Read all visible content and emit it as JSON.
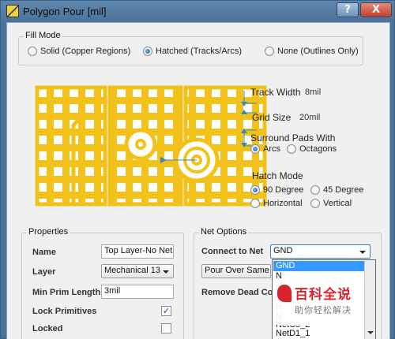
{
  "window": {
    "title": "Polygon Pour [mil]",
    "help_label": "?",
    "close_label": "X"
  },
  "fill_mode": {
    "label": "Fill Mode",
    "options": [
      {
        "label": "Solid (Copper Regions)",
        "selected": false
      },
      {
        "label": "Hatched (Tracks/Arcs)",
        "selected": true
      },
      {
        "label": "None (Outlines Only)",
        "selected": false
      }
    ]
  },
  "hatch_params": {
    "track_width_label": "Track Width",
    "track_width_value": "8mil",
    "grid_size_label": "Grid Size",
    "grid_size_value": "20mil",
    "surround_label": "Surround Pads With",
    "surround_options": [
      {
        "label": "Arcs",
        "selected": true
      },
      {
        "label": "Octagons",
        "selected": false
      }
    ],
    "hatch_mode_label": "Hatch Mode",
    "hatch_mode_options": [
      {
        "label": "90 Degree",
        "selected": true
      },
      {
        "label": "45 Degree",
        "selected": false
      },
      {
        "label": "Horizontal",
        "selected": false
      },
      {
        "label": "Vertical",
        "selected": false
      }
    ]
  },
  "properties": {
    "label": "Properties",
    "name_label": "Name",
    "name_value": "Top Layer-No Net",
    "layer_label": "Layer",
    "layer_value": "Mechanical 13",
    "min_prim_label": "Min Prim Length",
    "min_prim_value": "3mil",
    "lock_primitives_label": "Lock Primitives",
    "lock_primitives_checked": true,
    "locked_label": "Locked",
    "locked_checked": false,
    "check_mark": "✓"
  },
  "net_options": {
    "label": "Net Options",
    "connect_label": "Connect to Net",
    "connect_value": "GND",
    "pour_over_value": "Pour Over Same Ne",
    "remove_dead_label": "Remove Dead Co",
    "dropdown_items": [
      "GND",
      "N",
      "N",
      "N",
      "N",
      "N",
      "NetC5_2",
      "NetD1_1"
    ],
    "dropdown_selected_index": 0
  },
  "watermark": {
    "title": "百科全说",
    "subtitle": "助你轻松解决"
  },
  "colors": {
    "copper": "#f2c21b",
    "dimension_arrow": "#2c8fb8",
    "selection": "#3399ff"
  }
}
